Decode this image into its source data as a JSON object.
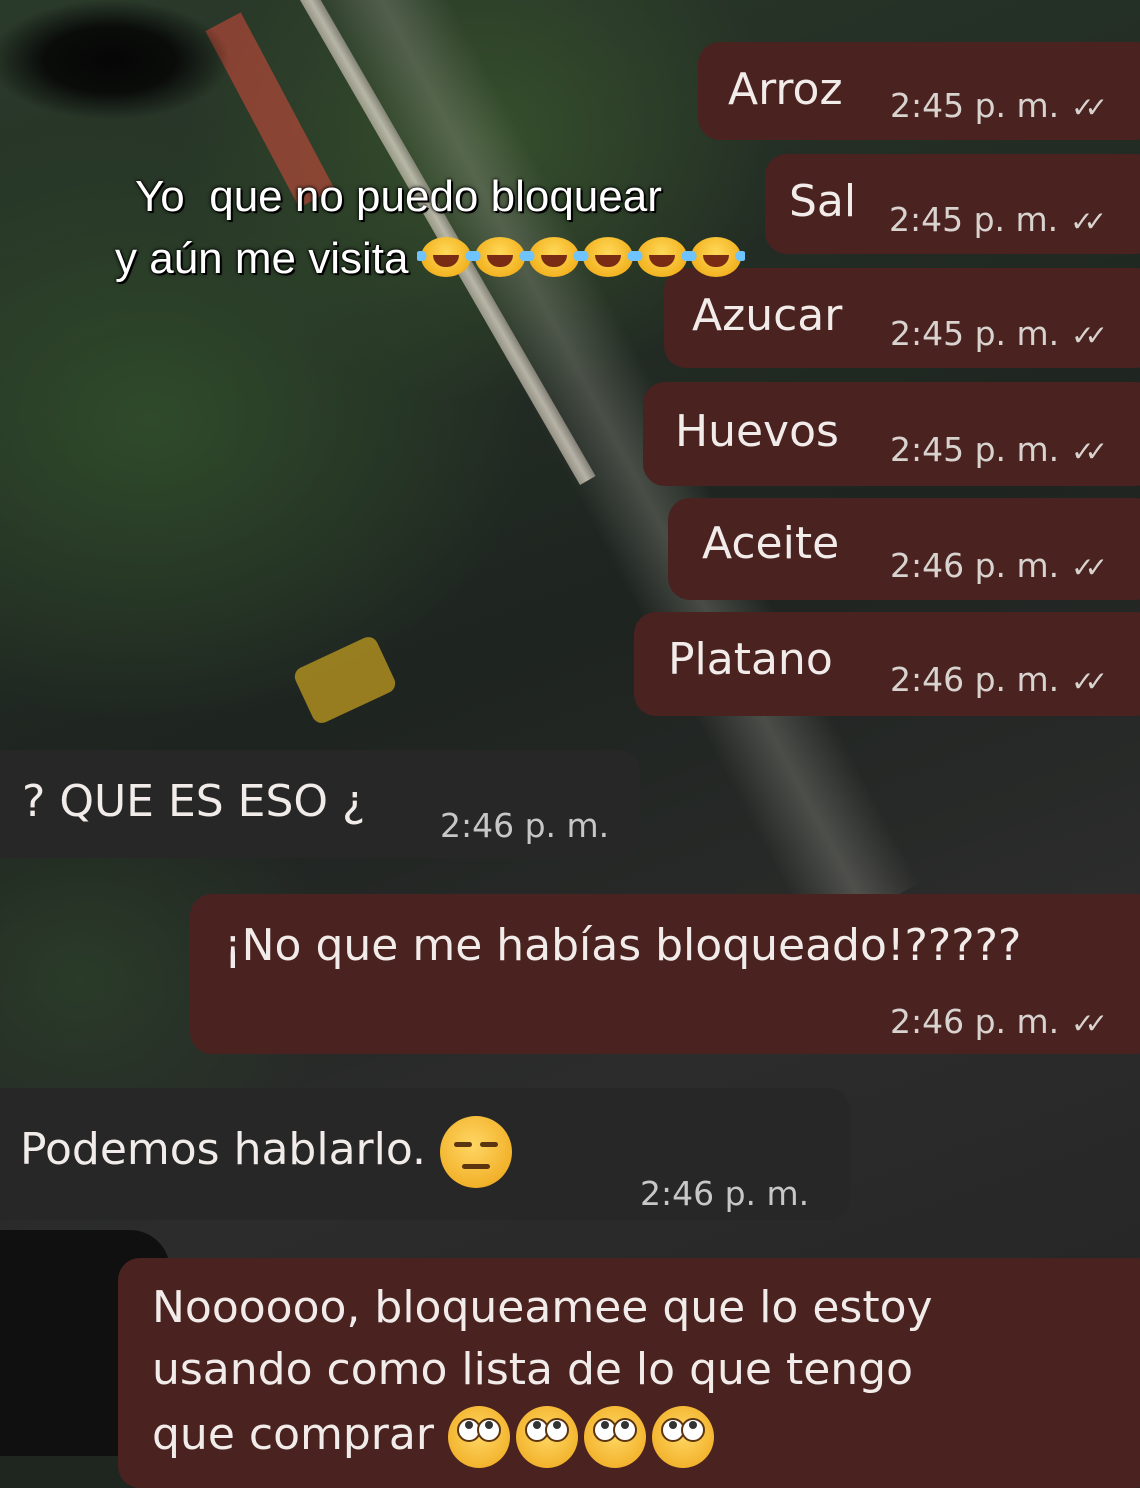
{
  "caption": {
    "line1": "Yo  que no puedo bloquear",
    "line2": "y aún me visita",
    "emoji_count": 6,
    "emoji_name": "laughing-tears-emoji"
  },
  "messages": [
    {
      "text": "Arroz",
      "time": "2:45 p. m.",
      "direction": "outgoing",
      "status": "read-double-check"
    },
    {
      "text": "Sal",
      "time": "2:45 p. m.",
      "direction": "outgoing",
      "status": "read-double-check"
    },
    {
      "text": "Azucar",
      "time": "2:45 p. m.",
      "direction": "outgoing",
      "status": "read-double-check"
    },
    {
      "text": "Huevos",
      "time": "2:45 p. m.",
      "direction": "outgoing",
      "status": "read-double-check"
    },
    {
      "text": "Aceite",
      "time": "2:46 p. m.",
      "direction": "outgoing",
      "status": "read-double-check"
    },
    {
      "text": "Platano",
      "time": "2:46 p. m.",
      "direction": "outgoing",
      "status": "read-double-check"
    },
    {
      "text": "? QUE ES ESO ¿",
      "time": "2:46 p. m.",
      "direction": "incoming"
    },
    {
      "text": "¡No que me habías bloqueado!?????",
      "time": "2:46 p. m.",
      "direction": "outgoing",
      "status": "read-double-check"
    },
    {
      "text": "Podemos hablarlo.",
      "time": "2:46 p. m.",
      "direction": "incoming",
      "emoji": "expressionless-face-emoji"
    },
    {
      "lines": [
        "Noooooo, bloqueamee que lo estoy",
        "usando como lista de lo que tengo",
        "que comprar"
      ],
      "direction": "outgoing",
      "emoji": "rolling-eyes-emoji"
    }
  ],
  "ticks_glyph": "✓✓",
  "colors": {
    "outgoing_bubble": "#4a2220",
    "incoming_bubble": "#262726",
    "text": "#f1ece9"
  }
}
